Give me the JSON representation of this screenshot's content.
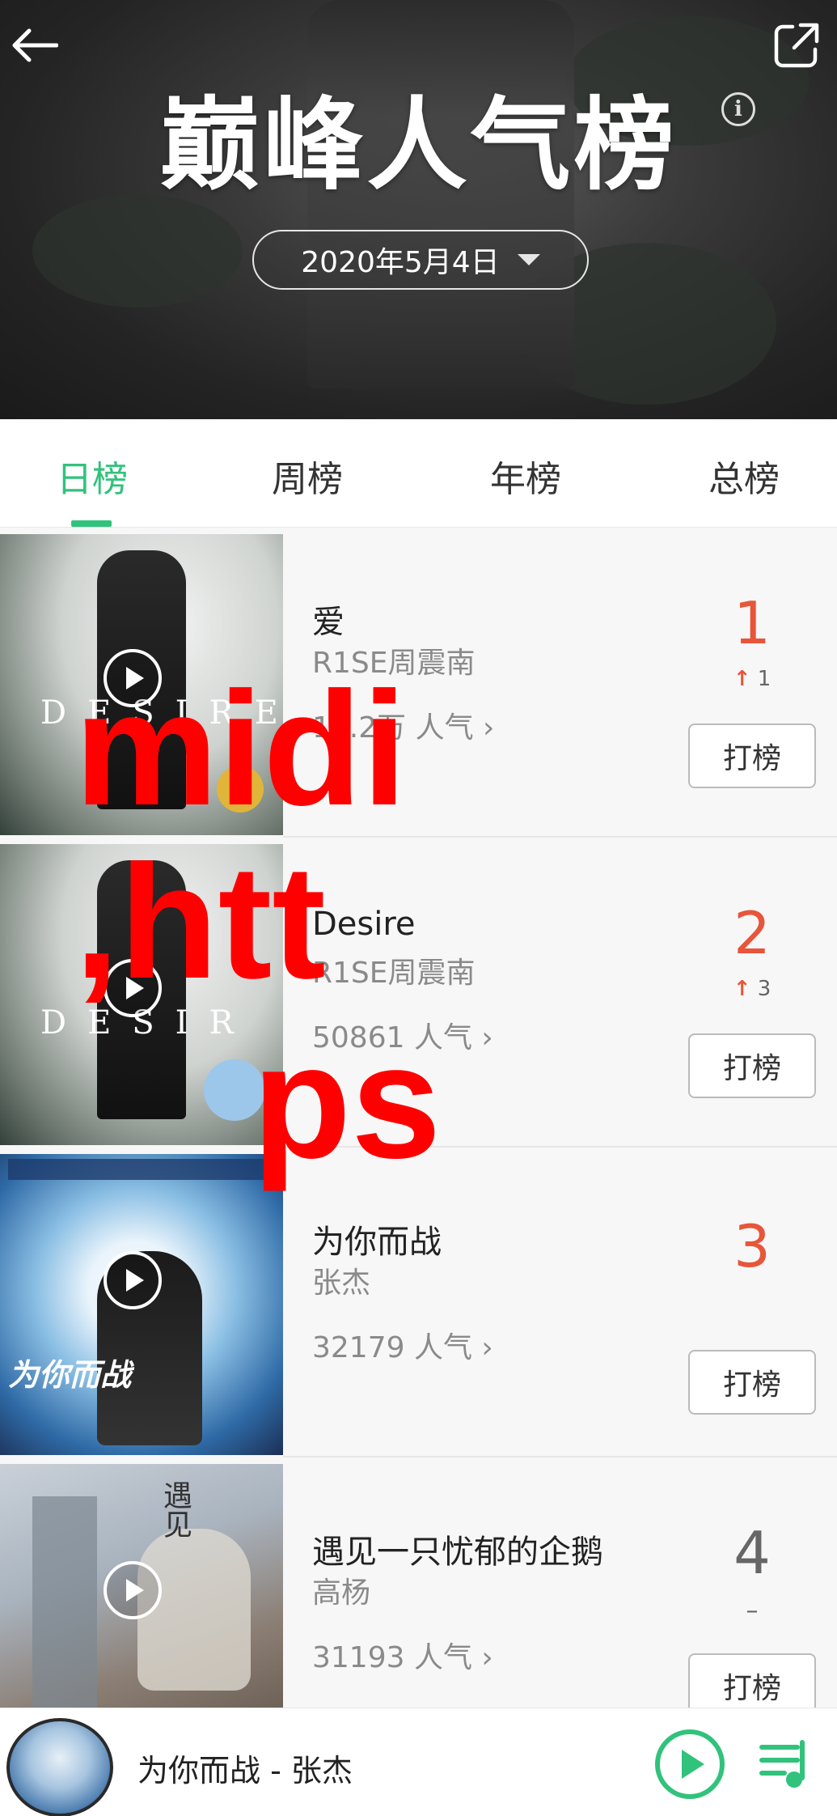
{
  "header": {
    "title": "巅峰人气榜",
    "date": "2020年5月4日"
  },
  "tabs": [
    {
      "label": "日榜",
      "active": true
    },
    {
      "label": "周榜",
      "active": false
    },
    {
      "label": "年榜",
      "active": false
    },
    {
      "label": "总榜",
      "active": false
    }
  ],
  "songs": [
    {
      "title": "爱",
      "artist": "R1SE周震南",
      "popularity": "13.2万 人气",
      "rank": "1",
      "change": "1",
      "change_dir": "up",
      "vote_label": "打榜",
      "cover_text": "DESIRE"
    },
    {
      "title": "Desire",
      "artist": "R1SE周震南",
      "popularity": "50861 人气",
      "rank": "2",
      "change": "3",
      "change_dir": "up",
      "vote_label": "打榜",
      "cover_text": "DESIR"
    },
    {
      "title": "为你而战",
      "artist": "张杰",
      "popularity": "32179 人气",
      "rank": "3",
      "change": "",
      "change_dir": "none",
      "vote_label": "打榜",
      "cover_text": "为你而战"
    },
    {
      "title": "遇见一只忧郁的企鹅",
      "artist": "高杨",
      "popularity": "31193 人气",
      "rank": "4",
      "change": "–",
      "change_dir": "same",
      "vote_label": "打榜",
      "cover_text": "遇见"
    }
  ],
  "watermark": {
    "line1": "midi",
    "line2": ",htt",
    "line3": "ps",
    "color": "#ff0000"
  },
  "player": {
    "now_playing": "为你而战 - 张杰"
  },
  "colors": {
    "accent": "#31c27c",
    "rank_red": "#e8553a"
  }
}
